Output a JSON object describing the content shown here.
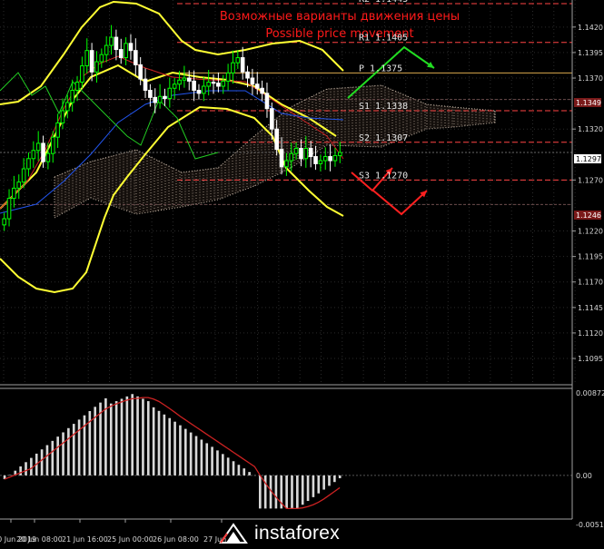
{
  "annotations": {
    "title_ru": "Возможные варианты движения цены",
    "title_en": "Possible price movement"
  },
  "levels": [
    {
      "label": "R2 1.1443",
      "value": 1.1443
    },
    {
      "label": "R1 1.1405",
      "value": 1.1405
    },
    {
      "label": "P 1.1375",
      "value": 1.1375
    },
    {
      "label": "S1 1.1338",
      "value": 1.1338
    },
    {
      "label": "S2 1.1307",
      "value": 1.1307
    },
    {
      "label": "S3 1.1270",
      "value": 1.127
    }
  ],
  "tags": {
    "bid": "1.1297",
    "tag_1349": "1.1349",
    "tag_1246": "1.1246"
  },
  "colors": {
    "bull": "#00ff00",
    "bear": "#ffffff",
    "bollinger": "#ffff33",
    "level": "#ff4444",
    "cloud": "#c8b8a8",
    "red_arrow": "#ff2020",
    "green_arrow": "#22dd22"
  },
  "watermark": "instaforex",
  "chart_data": [
    {
      "type": "candlestick",
      "ylim": [
        1.1095,
        1.1443
      ],
      "y_ticks": [
        "1.1420",
        "1.1395",
        "1.1370",
        "1.1349",
        "1.1320",
        "1.1297",
        "1.1270",
        "1.1246",
        "1.1220",
        "1.1195",
        "1.1170",
        "1.1145",
        "1.1120",
        "1.1095"
      ],
      "x_labels": [
        "20 Jun 2019",
        "20 Jun 08:00",
        "21 Jun 16:00",
        "25 Jun 00:00",
        "26 Jun 08:00",
        "27 Jun"
      ],
      "close": [
        1.1232,
        1.1252,
        1.1262,
        1.1268,
        1.1281,
        1.1291,
        1.1299,
        1.1306,
        1.1288,
        1.1296,
        1.1312,
        1.1326,
        1.1338,
        1.1346,
        1.1358,
        1.1366,
        1.1382,
        1.1397,
        1.1376,
        1.1386,
        1.1393,
        1.1402,
        1.141,
        1.1398,
        1.139,
        1.1404,
        1.1397,
        1.1383,
        1.1369,
        1.1358,
        1.1351,
        1.1346,
        1.1352,
        1.135,
        1.136,
        1.1364,
        1.1368,
        1.137,
        1.1367,
        1.1358,
        1.1355,
        1.1362,
        1.1366,
        1.1365,
        1.1362,
        1.1367,
        1.1375,
        1.1385,
        1.139,
        1.1376,
        1.137,
        1.1364,
        1.136,
        1.1355,
        1.134,
        1.132,
        1.13,
        1.1283,
        1.1289,
        1.1296,
        1.1301,
        1.1291,
        1.1301,
        1.1293,
        1.1286,
        1.1289,
        1.1293,
        1.1289,
        1.1294,
        1.1297
      ]
    },
    {
      "type": "histogram",
      "ylim": [
        -0.00519,
        0.00872
      ],
      "y_ticks": [
        "0.00872",
        "0.00",
        "-0.00519"
      ]
    }
  ]
}
